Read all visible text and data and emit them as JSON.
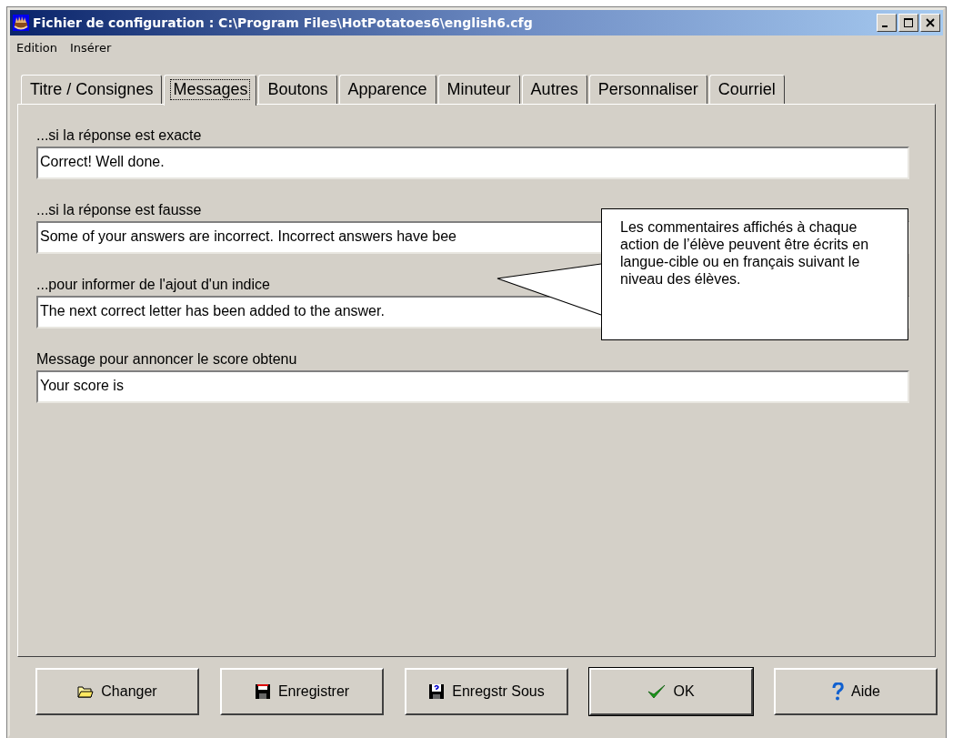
{
  "window": {
    "title": "Fichier de configuration : C:\\Program Files\\HotPotatoes6\\english6.cfg"
  },
  "menu": [
    "Edition",
    "Insérer"
  ],
  "tabs": [
    {
      "label": "Titre / Consignes",
      "selected": false
    },
    {
      "label": "Messages",
      "selected": true
    },
    {
      "label": "Boutons",
      "selected": false
    },
    {
      "label": "Apparence",
      "selected": false
    },
    {
      "label": "Minuteur",
      "selected": false
    },
    {
      "label": "Autres",
      "selected": false
    },
    {
      "label": "Personnaliser",
      "selected": false
    },
    {
      "label": "Courriel",
      "selected": false
    }
  ],
  "fields": [
    {
      "label": "...si la réponse est exacte",
      "value": "Correct! Well done."
    },
    {
      "label": "...si la réponse est fausse",
      "value": "Some of your answers are incorrect. Incorrect answers have bee"
    },
    {
      "label": "...pour informer de l'ajout d'un indice",
      "value": "The next correct letter has been added to the answer."
    },
    {
      "label": "Message pour annoncer le score obtenu",
      "value": "Your score is"
    }
  ],
  "callout": {
    "text": "Les commentaires affichés à chaque action de l’élève peuvent être écrits en langue-cible ou en français suivant le niveau des élèves."
  },
  "buttons": [
    {
      "label": "Changer",
      "kind": "folder",
      "default": false
    },
    {
      "label": "Enregistrer",
      "kind": "save",
      "default": false
    },
    {
      "label": "Enregstr Sous",
      "kind": "saveas",
      "default": false
    },
    {
      "label": "OK",
      "kind": "ok",
      "default": true
    },
    {
      "label": "Aide",
      "kind": "help",
      "default": false
    }
  ]
}
